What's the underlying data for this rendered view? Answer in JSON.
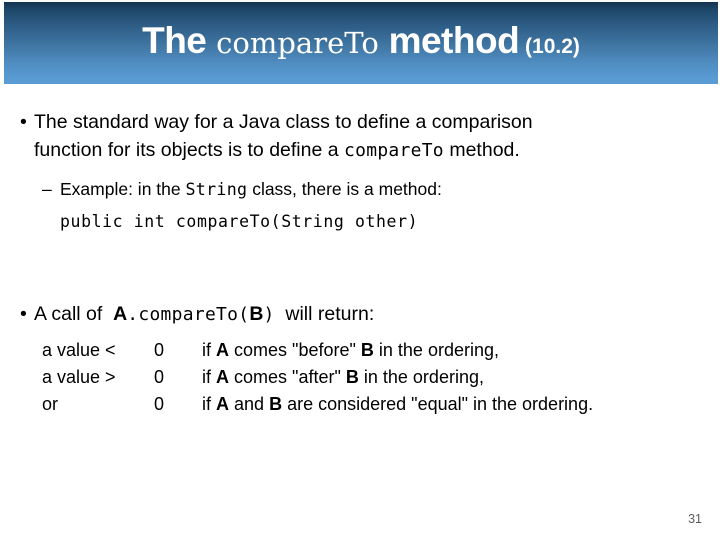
{
  "slide": {
    "title": {
      "part_bold_1": "The",
      "part_mono": "compareTo",
      "part_bold_2": "method",
      "reference": "(10.2)"
    },
    "banner_gradient_top": "#16334f",
    "banner_gradient_bottom": "#5a9bd3",
    "bullets": [
      {
        "marker": "•",
        "line1": "The standard way for a Java class to define a comparison",
        "line2_pre": "function for its objects is to define a",
        "line2_mono": "compareTo",
        "line2_post": "method."
      }
    ],
    "sub_bullet": {
      "marker": "–",
      "text_pre": "Example: in the",
      "text_mono": "String",
      "text_post": "class, there is a method:"
    },
    "code_line": "public int compareTo(String other)",
    "second_bullet": {
      "marker": "•",
      "text_pre": "A call of",
      "obj_a": "A",
      "mono_dot": ".",
      "mono_method": "compareTo(",
      "obj_b": "B",
      "mono_close": ")",
      "text_post": "will return:"
    },
    "return_rows": [
      {
        "condition": "a value <",
        "value": "0",
        "desc_pre": "if",
        "a": "A",
        "desc_mid": "comes \"before\"",
        "b": "B",
        "desc_post": "in the ordering,"
      },
      {
        "condition": "a value >",
        "value": "0",
        "desc_pre": "if",
        "a": "A",
        "desc_mid": "comes \"after\"",
        "b": "B",
        "desc_post": "in the ordering,"
      },
      {
        "condition": "or",
        "value": "0",
        "desc_pre": "if",
        "a": "A",
        "desc_mid": "and",
        "b": "B",
        "desc_post": "are considered \"equal\" in the ordering."
      }
    ],
    "page_number": "31"
  }
}
